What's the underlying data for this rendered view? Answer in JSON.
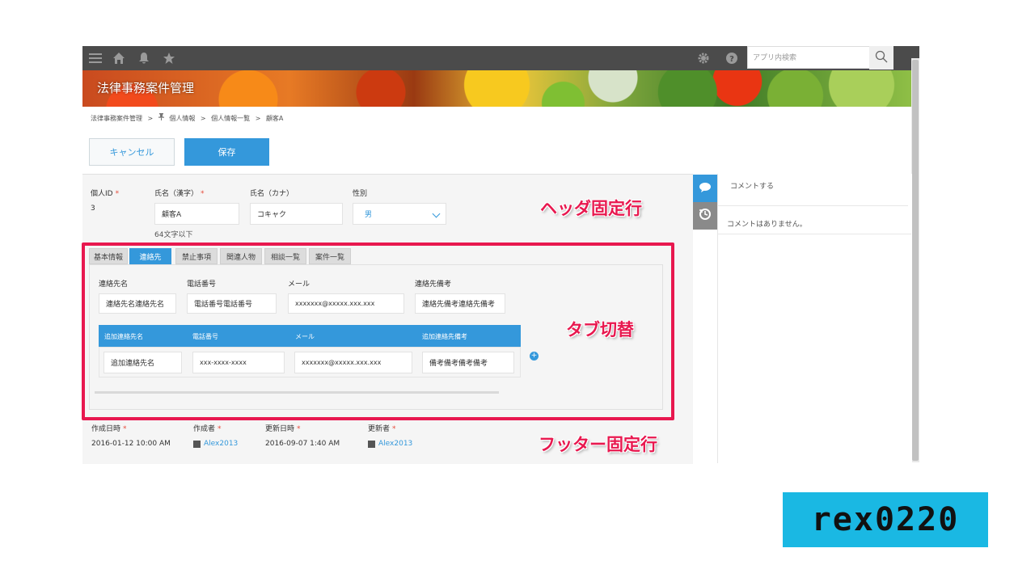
{
  "topbar": {
    "icons": [
      "menu-icon",
      "home-icon",
      "bell-icon",
      "star-icon",
      "gear-icon",
      "help-icon",
      "search-icon"
    ],
    "search_placeholder": "アプリ内検索"
  },
  "banner": {
    "title": "法律事務案件管理"
  },
  "breadcrumb": {
    "items": [
      "法律事務案件管理",
      ">",
      "個人情報",
      ">",
      "個人情報一覧",
      ">",
      "顧客A"
    ]
  },
  "actions": {
    "cancel_label": "キャンセル",
    "save_label": "保存"
  },
  "header_fields": {
    "id_label": "個人ID",
    "id_value": "3",
    "name_kanji_label": "氏名（漢字）",
    "name_kanji_value": "顧客A",
    "name_kanji_hint": "64文字以下",
    "name_kana_label": "氏名（カナ）",
    "name_kana_value": "コキャク",
    "gender_label": "性別",
    "gender_value": "男",
    "required_mark": "*"
  },
  "tabs": [
    "基本情報",
    "連絡先",
    "禁止事項",
    "関連人物",
    "相談一覧",
    "案件一覧"
  ],
  "contact": {
    "labels": [
      "連絡先名",
      "電話番号",
      "メール",
      "連絡先備考"
    ],
    "values": [
      "連絡先名連絡先名",
      "電話番号電話番号",
      "xxxxxxx@xxxxx.xxx.xxx",
      "連絡先備考連絡先備考"
    ]
  },
  "subtable": {
    "headers": [
      "追加連絡先名",
      "電話番号",
      "メール",
      "追加連絡先備考"
    ],
    "row": [
      "追加連絡先名",
      "xxx-xxxx-xxxx",
      "xxxxxxx@xxxxx.xxx.xxx",
      "備考備考備考備考"
    ],
    "add_symbol": "+"
  },
  "footer_fields": {
    "created_at_label": "作成日時",
    "created_at_value": "2016-01-12 10:00 AM",
    "creator_label": "作成者",
    "creator_value": "Alex2013",
    "updated_at_label": "更新日時",
    "updated_at_value": "2016-09-07 1:40 AM",
    "updater_label": "更新者",
    "updater_value": "Alex2013"
  },
  "comments": {
    "input_placeholder": "コメントする",
    "empty_text": "コメントはありません。"
  },
  "annotations": {
    "header": "ヘッダ固定行",
    "tabs": "タブ切替",
    "footer": "フッター固定行"
  },
  "logo": {
    "text": "rex0220"
  },
  "colors": {
    "accent": "#3498db",
    "highlight": "#e8184f",
    "topbar": "#4b4b4b",
    "logo_bg": "#1ab8e3"
  }
}
